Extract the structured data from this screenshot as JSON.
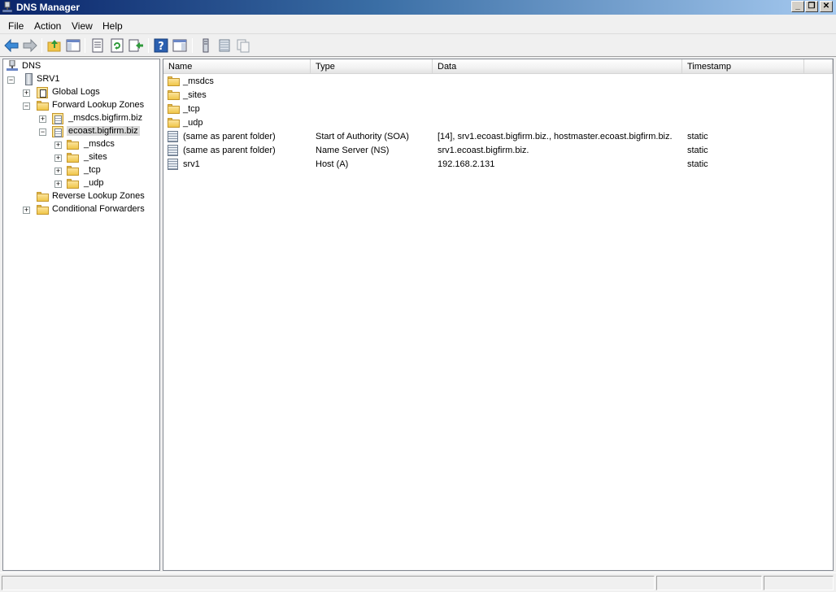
{
  "window": {
    "title": "DNS Manager"
  },
  "window_controls": {
    "minimize": "_",
    "restore": "❐",
    "close": "✕"
  },
  "menu": [
    "File",
    "Action",
    "View",
    "Help"
  ],
  "toolbar": [
    "back-icon",
    "forward-icon",
    "up-folder-icon",
    "show-hide-tree-icon",
    "properties-icon",
    "refresh-icon",
    "export-list-icon",
    "help-icon",
    "show-hide-action-pane-icon",
    "server-icon",
    "record-icon",
    "zone-delegation-icon"
  ],
  "tree": {
    "root": "DNS",
    "server": "SRV1",
    "global_logs": "Global Logs",
    "forward_lookup_zones": "Forward Lookup Zones",
    "zone_msdcs": "_msdcs.bigfirm.biz",
    "zone_ecoast": "ecoast.bigfirm.biz",
    "sub_msdcs": "_msdcs",
    "sub_sites": "_sites",
    "sub_tcp": "_tcp",
    "sub_udp": "_udp",
    "reverse_lookup_zones": "Reverse Lookup Zones",
    "conditional_forwarders": "Conditional Forwarders",
    "expand_plus": "+",
    "expand_minus": "−"
  },
  "columns": {
    "name": "Name",
    "type": "Type",
    "data": "Data",
    "timestamp": "Timestamp"
  },
  "rows": [
    {
      "name": "_msdcs",
      "type": "",
      "data": "",
      "timestamp": "",
      "icon": "folder-icon"
    },
    {
      "name": "_sites",
      "type": "",
      "data": "",
      "timestamp": "",
      "icon": "folder-icon"
    },
    {
      "name": "_tcp",
      "type": "",
      "data": "",
      "timestamp": "",
      "icon": "folder-icon"
    },
    {
      "name": "_udp",
      "type": "",
      "data": "",
      "timestamp": "",
      "icon": "folder-icon"
    },
    {
      "name": "(same as parent folder)",
      "type": "Start of Authority (SOA)",
      "data": "[14], srv1.ecoast.bigfirm.biz., hostmaster.ecoast.bigfirm.biz.",
      "timestamp": "static",
      "icon": "record-icon"
    },
    {
      "name": "(same as parent folder)",
      "type": "Name Server (NS)",
      "data": "srv1.ecoast.bigfirm.biz.",
      "timestamp": "static",
      "icon": "record-icon"
    },
    {
      "name": "srv1",
      "type": "Host (A)",
      "data": "192.168.2.131",
      "timestamp": "static",
      "icon": "record-icon"
    }
  ]
}
